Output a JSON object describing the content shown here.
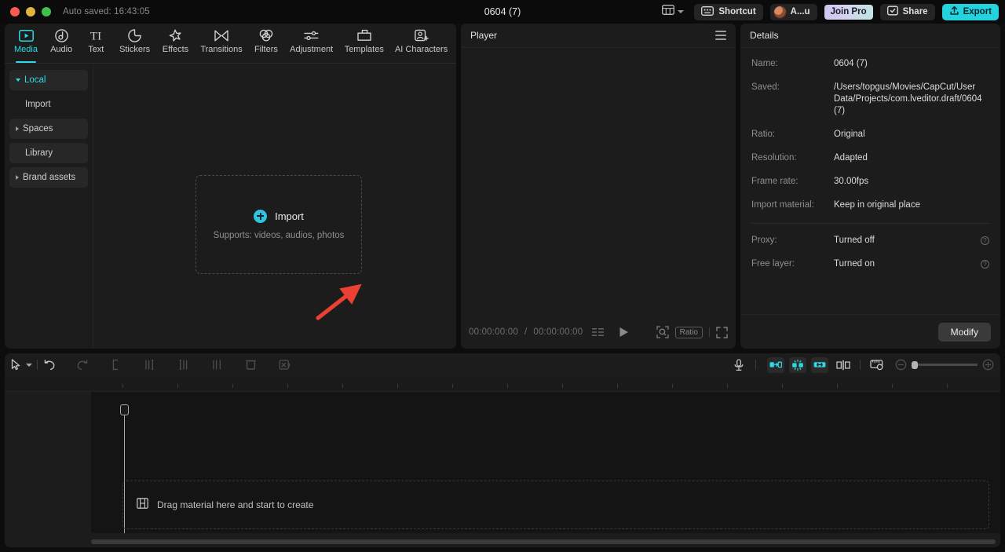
{
  "titlebar": {
    "autosave": "Auto saved: 16:43:05",
    "project_title": "0604 (7)",
    "layout_icon": "layout-grid-icon",
    "shortcut_label": "Shortcut",
    "account_label": "A...u",
    "join_pro_label": "Join Pro",
    "share_label": "Share",
    "export_label": "Export",
    "accent_export": "#25d3de",
    "accent_active": "#2fd9e3"
  },
  "tabs": [
    {
      "label": "Media",
      "icon": "media-icon",
      "active": true
    },
    {
      "label": "Audio",
      "icon": "audio-icon",
      "active": false
    },
    {
      "label": "Text",
      "icon": "text-icon",
      "active": false
    },
    {
      "label": "Stickers",
      "icon": "stickers-icon",
      "active": false
    },
    {
      "label": "Effects",
      "icon": "effects-icon",
      "active": false
    },
    {
      "label": "Transitions",
      "icon": "transitions-icon",
      "active": false
    },
    {
      "label": "Filters",
      "icon": "filters-icon",
      "active": false
    },
    {
      "label": "Adjustment",
      "icon": "adjustment-icon",
      "active": false
    },
    {
      "label": "Templates",
      "icon": "templates-icon",
      "active": false
    },
    {
      "label": "AI Characters",
      "icon": "ai-characters-icon",
      "active": false
    }
  ],
  "sidebar": {
    "items": [
      {
        "label": "Local",
        "marker": "down",
        "active": true,
        "filled": true
      },
      {
        "label": "Import",
        "marker": "none",
        "active": false,
        "filled": false
      },
      {
        "label": "Spaces",
        "marker": "right",
        "active": false,
        "filled": true
      },
      {
        "label": "Library",
        "marker": "none",
        "active": false,
        "filled": true
      },
      {
        "label": "Brand assets",
        "marker": "right",
        "active": false,
        "filled": true
      }
    ]
  },
  "dropzone": {
    "label": "Import",
    "sub": "Supports: videos, audios, photos",
    "plus_icon": "plus-circle-icon",
    "annotation_arrow_color": "#ec4034"
  },
  "player": {
    "title": "Player",
    "menu_icon": "hamburger-menu-icon",
    "current_time": "00:00:00:00",
    "total_time": "00:00:00:00",
    "separator": "/",
    "play_icon": "play-icon",
    "quality_icon": "quality-levels-icon",
    "zoom_icon": "zoom-fit-icon",
    "ratio_label": "Ratio",
    "fullscreen_icon": "fullscreen-icon"
  },
  "details": {
    "title": "Details",
    "rows": [
      {
        "key": "Name:",
        "value": "0604 (7)"
      },
      {
        "key": "Saved:",
        "value": "/Users/topgus/Movies/CapCut/User Data/Projects/com.lveditor.draft/0604 (7)"
      },
      {
        "key": "Ratio:",
        "value": "Original"
      },
      {
        "key": "Resolution:",
        "value": "Adapted"
      },
      {
        "key": "Frame rate:",
        "value": "30.00fps"
      },
      {
        "key": "Import material:",
        "value": "Keep in original place"
      }
    ],
    "toggle_rows": [
      {
        "key": "Proxy:",
        "value": "Turned off",
        "help": "help-icon"
      },
      {
        "key": "Free layer:",
        "value": "Turned on",
        "help": "help-icon"
      }
    ],
    "modify_label": "Modify"
  },
  "timeline": {
    "tools_left": [
      {
        "name": "select-tool",
        "icon": "cursor-icon",
        "enabled": true
      },
      {
        "name": "tool-dropdown",
        "icon": "chevron-down-icon",
        "enabled": true
      },
      {
        "name": "undo",
        "icon": "undo-icon",
        "enabled": true
      },
      {
        "name": "redo",
        "icon": "redo-icon",
        "enabled": false
      },
      {
        "name": "split",
        "icon": "split-icon",
        "enabled": false
      },
      {
        "name": "trim-left",
        "icon": "trim-left-icon",
        "enabled": false
      },
      {
        "name": "trim-right",
        "icon": "trim-right-icon",
        "enabled": false
      },
      {
        "name": "delete",
        "icon": "delete-icon",
        "enabled": false
      },
      {
        "name": "mute",
        "icon": "mute-icon",
        "enabled": false
      }
    ],
    "tools_right": [
      {
        "name": "record-voiceover",
        "icon": "microphone-icon",
        "active": false
      },
      {
        "name": "snap-start",
        "icon": "adsorption-icon",
        "active": true
      },
      {
        "name": "magnet-snap",
        "icon": "magnet-icon",
        "active": true
      },
      {
        "name": "link-clips",
        "icon": "link-icon",
        "active": true
      },
      {
        "name": "split-mode",
        "icon": "split-mode-icon",
        "active": false
      },
      {
        "name": "preview-quality",
        "icon": "ruler-preview-icon",
        "active": false
      }
    ],
    "zoom_out_icon": "zoom-out-icon",
    "zoom_in_icon": "zoom-in-icon",
    "zoom_value": 0,
    "placeholder": "Drag material here and start to create",
    "placeholder_icon": "film-strip-icon"
  }
}
